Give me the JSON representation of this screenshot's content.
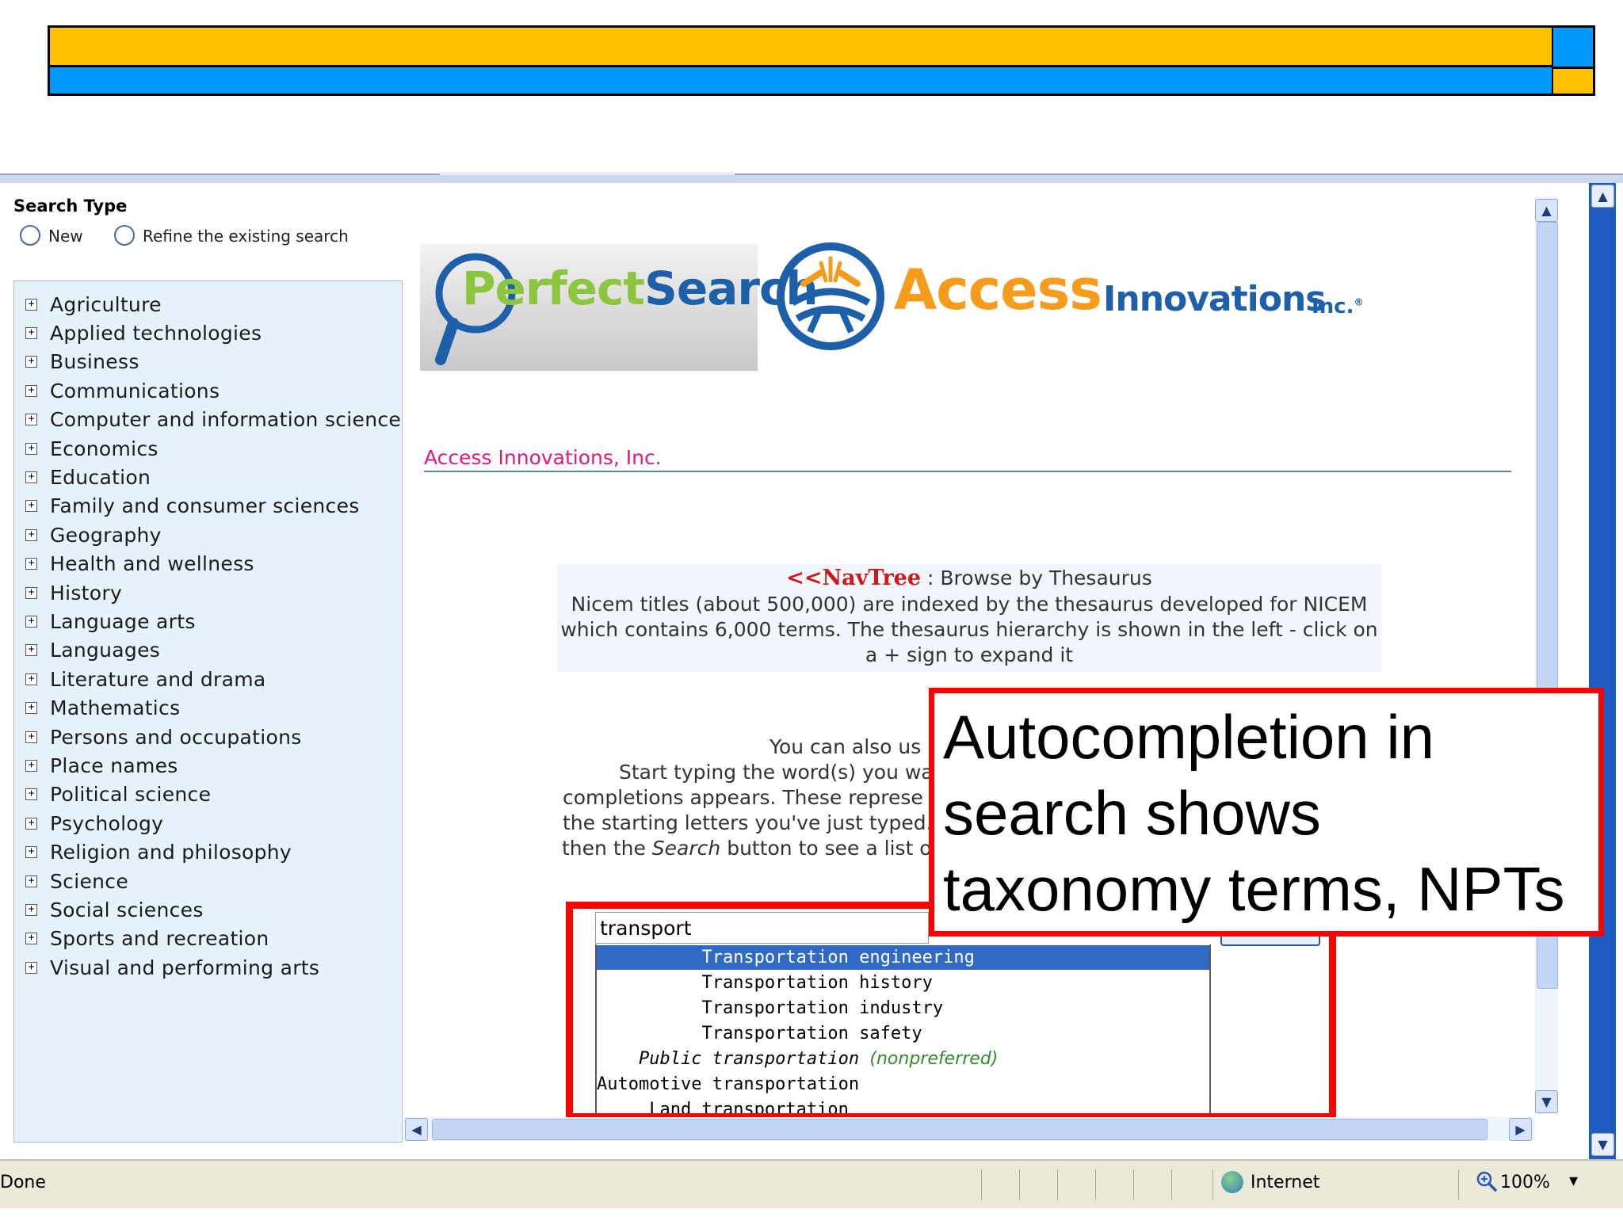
{
  "search_type": {
    "title": "Search Type",
    "options": [
      {
        "label": "New",
        "selected": false
      },
      {
        "label": "Refine the existing search",
        "selected": false
      }
    ]
  },
  "tree": {
    "items": [
      "Agriculture",
      "Applied technologies",
      "Business",
      "Communications",
      "Computer and information science",
      "Economics",
      "Education",
      "Family and consumer sciences",
      "Geography",
      "Health and wellness",
      "History",
      "Language arts",
      "Languages",
      "Literature and drama",
      "Mathematics",
      "Persons and occupations",
      "Place names",
      "Political science",
      "Psychology",
      "Religion and philosophy",
      "Science",
      "Social sciences",
      "Sports and recreation",
      "Visual and performing arts"
    ],
    "toggle_symbol": "+"
  },
  "logos": {
    "perfectsearch_a": "Perfect",
    "perfectsearch_b": "Search",
    "access": "Access",
    "innovations": "Innovations",
    "inc": "Inc.",
    "registered": "®"
  },
  "company_link": "Access Innovations, Inc.",
  "info_box": {
    "navtree_arrows": "<<",
    "navtree_title": "NavTree",
    "browse_text": " : Browse by Thesaurus",
    "line2": "Nicem titles (about 500,000) are indexed by the thesaurus developed for NICEM",
    "line3": "which contains 6,000 terms. The thesaurus hierarchy is shown in the left - click on",
    "line4": "a + sign to expand it"
  },
  "autocomplete_help": {
    "line1": "You can also us",
    "line2": "Start typing the word(s) you wa",
    "line3": "completions appears. These represe",
    "line4": "the starting letters you've just typed.",
    "line5_a": "then the ",
    "line5_em": "Search",
    "line5_b": " button to see a list o"
  },
  "search": {
    "value": "transport"
  },
  "suggestions": [
    {
      "prefix": "          ",
      "text": "Transportation engineering",
      "selected": true
    },
    {
      "prefix": "          ",
      "text": "Transportation history",
      "selected": false
    },
    {
      "prefix": "          ",
      "text": "Transportation industry",
      "selected": false
    },
    {
      "prefix": "          ",
      "text": "Transportation safety",
      "selected": false
    },
    {
      "prefix": "    ",
      "text": "Public transportation",
      "nonpreferred": "(nonpreferred)",
      "selected": false
    },
    {
      "prefix": "",
      "text": "Automotive transportation",
      "selected": false
    },
    {
      "prefix": "     ",
      "text": "Land transportation",
      "selected": false
    }
  ],
  "callout": {
    "line1": "Autocompletion in",
    "line2": "search shows",
    "line3": "taxonomy terms, NPTs"
  },
  "statusbar": {
    "status": "Done",
    "zone": "Internet",
    "zoom": "100%",
    "zoom_dropdown": "▾"
  },
  "colors": {
    "banner_yellow": "#ffc000",
    "banner_blue": "#0099ff",
    "callout_red": "#ff0000",
    "selected_suggestion": "#316ac5",
    "link_pink": "#e0197e"
  }
}
